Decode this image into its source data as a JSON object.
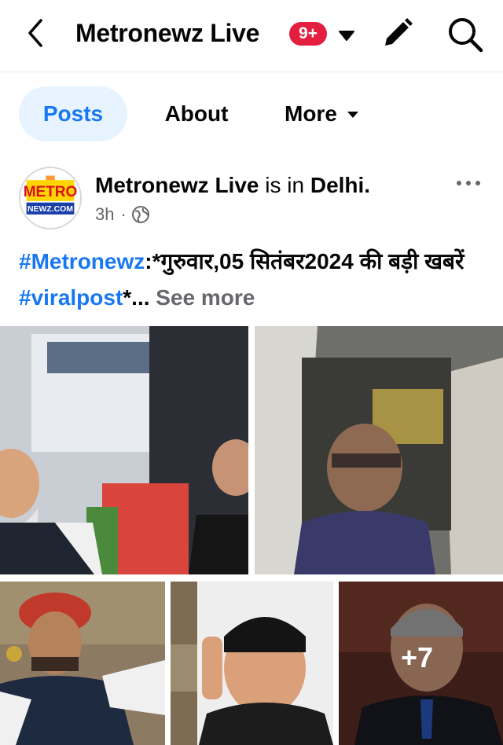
{
  "header": {
    "title": "Metronewz Live",
    "notification_badge": "9+",
    "badge_color": "#e41e3f"
  },
  "tabs": [
    {
      "label": "Posts",
      "active": true
    },
    {
      "label": "About",
      "active": false
    },
    {
      "label": "More",
      "active": false
    }
  ],
  "post": {
    "author": "Metronewz Live",
    "is_in": "is in",
    "location": "Delhi.",
    "time": "3h",
    "dot": "·",
    "hashtag_1": "#Metronewz",
    "text_1": ":*गुरुवार,05 सितंबर2024 की  बड़ी खबरें ",
    "hashtag_2": "#viralpost",
    "text_2": "*...",
    "see_more": "See more",
    "more_photos": "+7"
  },
  "avatar_logo": {
    "line_1": "METRO",
    "line_2": "NEWZ.COM"
  },
  "colors": {
    "accent": "#1877f2",
    "active_tab_bg": "#e7f3ff",
    "secondary_text": "#65676b"
  },
  "icons": {
    "back": "chevron-left-icon",
    "dropdown": "caret-down-icon",
    "edit": "pencil-icon",
    "search": "search-icon",
    "privacy": "globe-icon",
    "menu": "more-horizontal-icon"
  }
}
